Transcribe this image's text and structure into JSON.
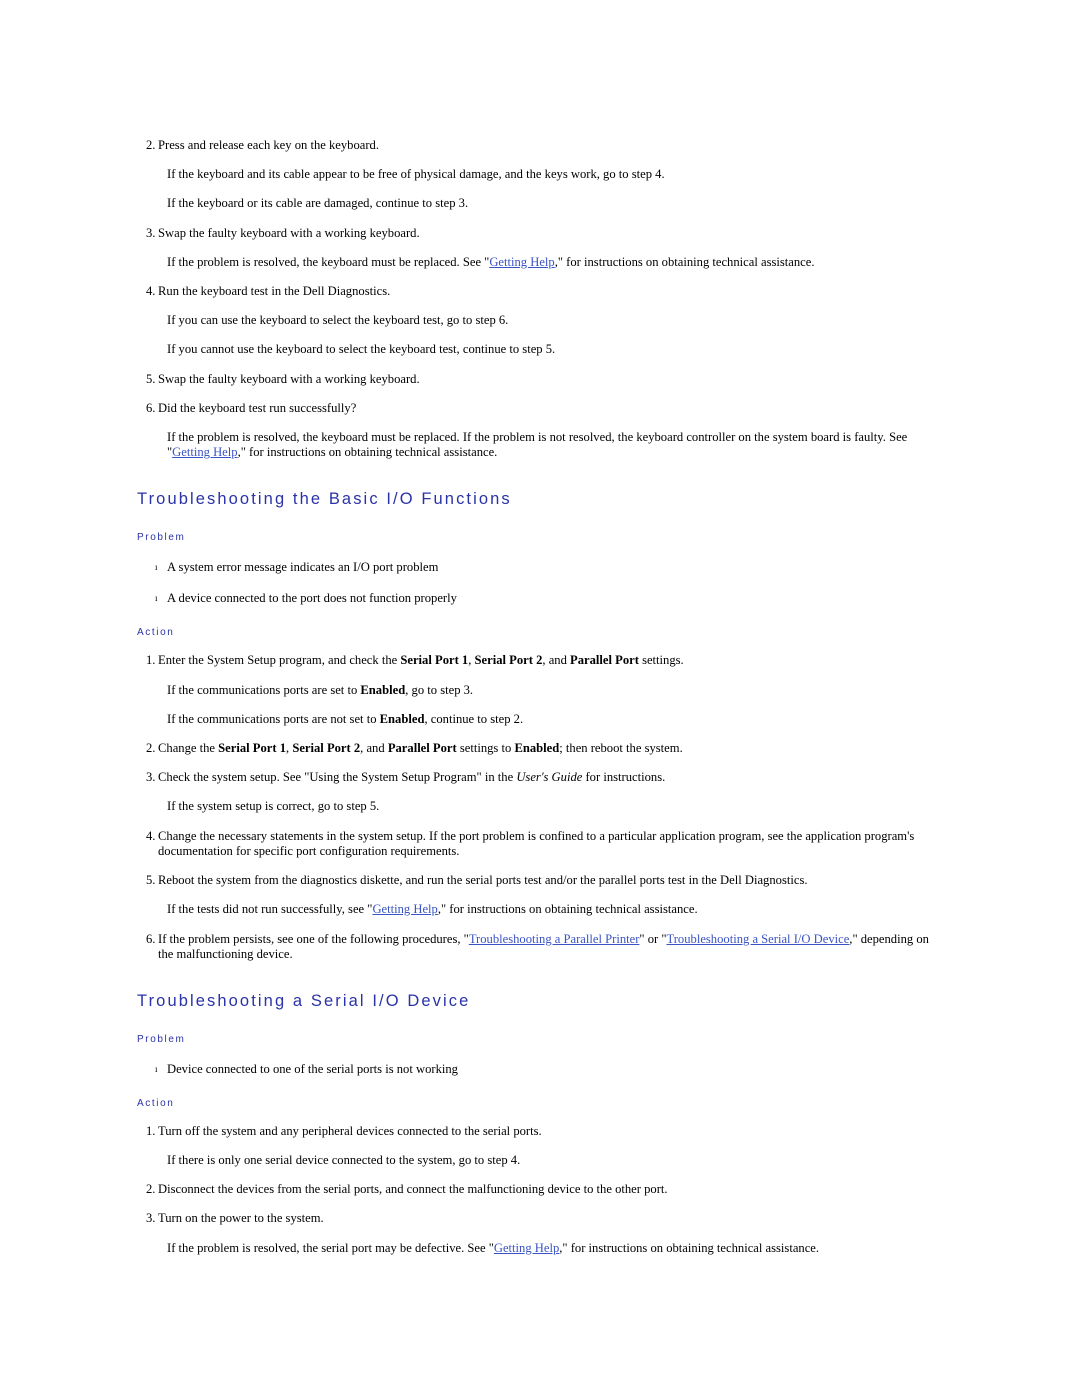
{
  "document": {
    "colors": {
      "heading": "#2A32A8",
      "subheading": "#2A32A8",
      "link": "#3A53C4",
      "body": "#000000",
      "background": "#ffffff"
    },
    "bullet_glyph": "ı"
  },
  "keyboard_steps": {
    "step2": {
      "num": "2.",
      "text": "Press and release each key on the keyboard."
    },
    "step2_note1": "If the keyboard and its cable appear to be free of physical damage, and the keys work, go to step 4.",
    "step2_note2": "If the keyboard or its cable are damaged, continue to step 3.",
    "step3": {
      "num": "3.",
      "text": "Swap the faulty keyboard with a working keyboard."
    },
    "step3_note": {
      "before": "If the problem is resolved, the keyboard must be replaced. See \"",
      "link": "Getting Help",
      "after": ",\" for instructions on obtaining technical assistance."
    },
    "step4": {
      "num": "4.",
      "text": "Run the keyboard test in the Dell Diagnostics."
    },
    "step4_note1": "If you can use the keyboard to select the keyboard test, go to step 6.",
    "step4_note2": "If you cannot use the keyboard to select the keyboard test, continue to step 5.",
    "step5": {
      "num": "5.",
      "text": "Swap the faulty keyboard with a working keyboard."
    },
    "step6": {
      "num": "6.",
      "text": "Did the keyboard test run successfully?"
    },
    "step6_note": {
      "before": "If the problem is resolved, the keyboard must be replaced. If the problem is not resolved, the keyboard controller on the system board is faulty. See \"",
      "link": "Getting Help",
      "after": ",\" for instructions on obtaining technical assistance."
    }
  },
  "basic_io": {
    "title": "Troubleshooting the Basic I/O Functions",
    "problem_label": "Problem",
    "action_label": "Action",
    "problems": [
      "A system error message indicates an I/O port problem",
      "A device connected to the port does not function properly"
    ],
    "step1": {
      "num": "1.",
      "p1": "Enter the System Setup program, and check the ",
      "b1": "Serial Port 1",
      "p2": ", ",
      "b2": "Serial Port 2",
      "p3": ", and ",
      "b3": "Parallel Port",
      "p4": " settings."
    },
    "step1_note1": {
      "before": "If the communications ports are set to ",
      "bold": "Enabled",
      "after": ", go to step 3."
    },
    "step1_note2": {
      "before": "If the communications ports are not set to ",
      "bold": "Enabled",
      "after": ", continue to step 2."
    },
    "step2": {
      "num": "2.",
      "p1": "Change the ",
      "b1": "Serial Port 1",
      "p2": ", ",
      "b2": "Serial Port 2",
      "p3": ", and ",
      "b3": "Parallel Port",
      "p4": " settings to ",
      "b4": "Enabled",
      "p5": "; then reboot the system."
    },
    "step3": {
      "num": "3.",
      "before": "Check the system setup. See \"Using the System Setup Program\" in the ",
      "italic": "User's Guide",
      "after": " for instructions."
    },
    "step3_note": "If the system setup is correct, go to step 5.",
    "step4": {
      "num": "4.",
      "text": "Change the necessary statements in the system setup. If the port problem is confined to a particular application program, see the application program's documentation for specific port configuration requirements."
    },
    "step5": {
      "num": "5.",
      "text": "Reboot the system from the diagnostics diskette, and run the serial ports test and/or the parallel ports test in the Dell Diagnostics."
    },
    "step5_note": {
      "before": "If the tests did not run successfully, see \"",
      "link": "Getting Help",
      "after": ",\" for instructions on obtaining technical assistance."
    },
    "step6": {
      "num": "6.",
      "before": "If the problem persists, see one of the following procedures, \"",
      "link1": "Troubleshooting a Parallel Printer",
      "middle": "\" or \"",
      "link2": "Troubleshooting a Serial I/O Device",
      "after": ",\" depending on the malfunctioning device."
    }
  },
  "serial_io": {
    "title": "Troubleshooting a Serial I/O Device",
    "problem_label": "Problem",
    "action_label": "Action",
    "problems": [
      "Device connected to one of the serial ports is not working"
    ],
    "step1": {
      "num": "1.",
      "text": "Turn off the system and any peripheral devices connected to the serial ports."
    },
    "step1_note": "If there is only one serial device connected to the system, go to step 4.",
    "step2": {
      "num": "2.",
      "text": "Disconnect the devices from the serial ports, and connect the malfunctioning device to the other port."
    },
    "step3": {
      "num": "3.",
      "text": "Turn on the power to the system."
    },
    "step3_note": {
      "before": "If the problem is resolved, the serial port may be defective. See \"",
      "link": "Getting Help",
      "after": ",\" for instructions on obtaining technical assistance."
    }
  }
}
